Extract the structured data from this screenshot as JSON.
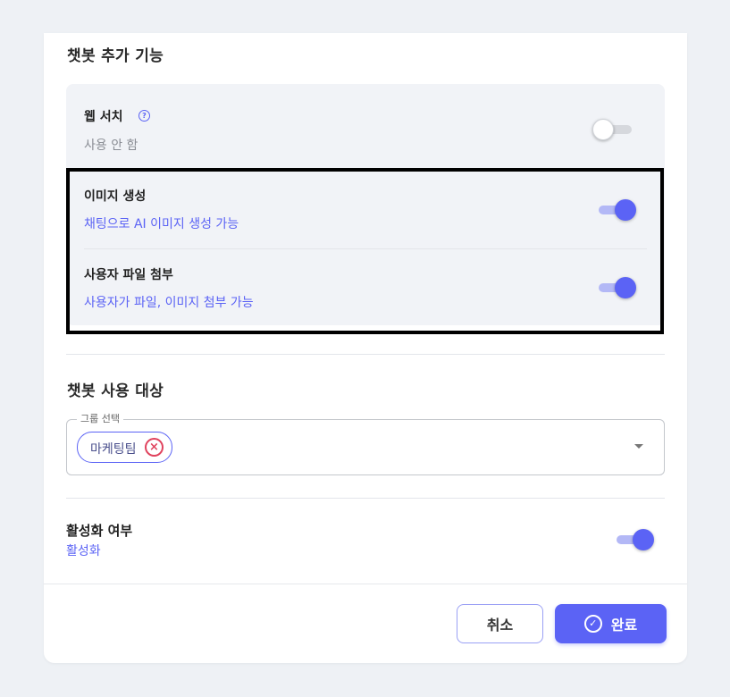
{
  "colors": {
    "accent": "#5b63f5",
    "remove": "#e0425d",
    "panel": "#f1f3f7"
  },
  "features": {
    "title": "챗봇 추가 기능",
    "items": [
      {
        "title": "웹 서치",
        "desc": "사용 안 함",
        "enabled": false,
        "help_icon": "question-circle-icon"
      },
      {
        "title": "이미지 생성",
        "desc": "채팅으로 AI 이미지 생성 가능",
        "enabled": true
      },
      {
        "title": "사용자 파일 첨부",
        "desc": "사용자가 파일, 이미지 첨부 가능",
        "enabled": true
      }
    ]
  },
  "target": {
    "title": "챗봇 사용 대상",
    "group_select": {
      "legend": "그룹 선택",
      "chips": [
        "마케팅팀"
      ]
    }
  },
  "activation": {
    "title": "활성화 여부",
    "value": "활성화",
    "enabled": true
  },
  "footer": {
    "cancel_label": "취소",
    "done_label": "완료"
  }
}
